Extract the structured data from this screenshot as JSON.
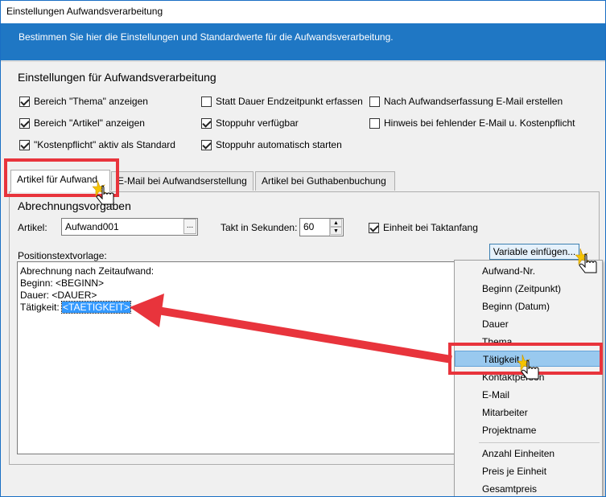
{
  "window": {
    "title": "Einstellungen Aufwandsverarbeitung"
  },
  "banner": {
    "text": "Bestimmen Sie hier die Einstellungen und Standardwerte für die Aufwandsverarbeitung."
  },
  "settings": {
    "title": "Einstellungen für Aufwandsverarbeitung",
    "checkboxes": [
      {
        "label": "Bereich \"Thema\" anzeigen",
        "checked": true
      },
      {
        "label": "Bereich \"Artikel\" anzeigen",
        "checked": true
      },
      {
        "label": "\"Kostenpflicht\" aktiv als Standard",
        "checked": true
      },
      {
        "label": "Statt Dauer Endzeitpunkt erfassen",
        "checked": false
      },
      {
        "label": "Stoppuhr verfügbar",
        "checked": true
      },
      {
        "label": "Stoppuhr automatisch starten",
        "checked": true
      },
      {
        "label": "Nach Aufwandserfassung E-Mail erstellen",
        "checked": false
      },
      {
        "label": "Hinweis bei fehlender E-Mail u. Kostenpflicht",
        "checked": false
      }
    ]
  },
  "tabs": [
    {
      "label": "Artikel für Aufwand",
      "active": true
    },
    {
      "label": "E-Mail bei Aufwandserstellung",
      "active": false
    },
    {
      "label": "Artikel bei Guthabenbuchung",
      "active": false
    }
  ],
  "panel": {
    "title": "Abrechnungsvorgaben",
    "artikel_label": "Artikel:",
    "artikel_value": "Aufwand001",
    "dots_label": "...",
    "takt_label": "Takt in Sekunden:",
    "takt_value": "60",
    "einheit_label": "Einheit bei Taktanfang",
    "einheit_checked": true,
    "template_label": "Positionstextvorlage:",
    "template_lines": [
      "Abrechnung nach Zeitaufwand:",
      "Beginn: <BEGINN>",
      "Dauer: <DAUER>"
    ],
    "template_last_prefix": "Tätigkeit: ",
    "template_last_selected": "<TAETIGKEIT>",
    "variable_button": "Variable einfügen..."
  },
  "menu": {
    "items": [
      "Aufwand-Nr.",
      "Beginn (Zeitpunkt)",
      "Beginn (Datum)",
      "Dauer",
      "Thema",
      "Tätigkeit",
      "Kontaktperson",
      "E-Mail",
      "Mitarbeiter",
      "Projektname",
      "Anzahl Einheiten",
      "Preis je Einheit",
      "Gesamtpreis"
    ],
    "highlighted": "Tätigkeit"
  },
  "colors": {
    "accent": "#1f77c4",
    "annotation": "#e8343c",
    "selection": "#3399ff",
    "menu_highlight": "#99c9ef"
  }
}
